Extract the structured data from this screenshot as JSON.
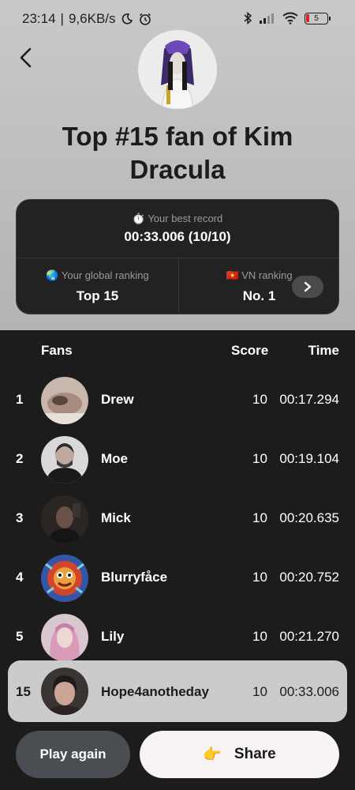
{
  "status_bar": {
    "time": "23:14",
    "network_speed": "9,6KB/s",
    "battery": "5"
  },
  "header": {
    "title": "Top #15 fan of Kim Dracula"
  },
  "record_card": {
    "best_label": "Your best record",
    "best_value": "00:33.006 (10/10)",
    "global_label": "Your global ranking",
    "global_value": "Top 15",
    "local_label": "VN ranking",
    "local_value": "No. 1"
  },
  "leaderboard": {
    "col_fans": "Fans",
    "col_score": "Score",
    "col_time": "Time",
    "rows": [
      {
        "rank": "1",
        "name": "Drew",
        "score": "10",
        "time": "00:17.294"
      },
      {
        "rank": "2",
        "name": "Moe",
        "score": "10",
        "time": "00:19.104"
      },
      {
        "rank": "3",
        "name": "Mick",
        "score": "10",
        "time": "00:20.635"
      },
      {
        "rank": "4",
        "name": "Blurryfåce",
        "score": "10",
        "time": "00:20.752"
      },
      {
        "rank": "5",
        "name": "Lily",
        "score": "10",
        "time": "00:21.270"
      }
    ],
    "me": {
      "rank": "15",
      "name": "Hope4anotheday",
      "score": "10",
      "time": "00:33.006"
    }
  },
  "actions": {
    "play_again": "Play again",
    "share": "Share",
    "share_emoji": "👉"
  }
}
